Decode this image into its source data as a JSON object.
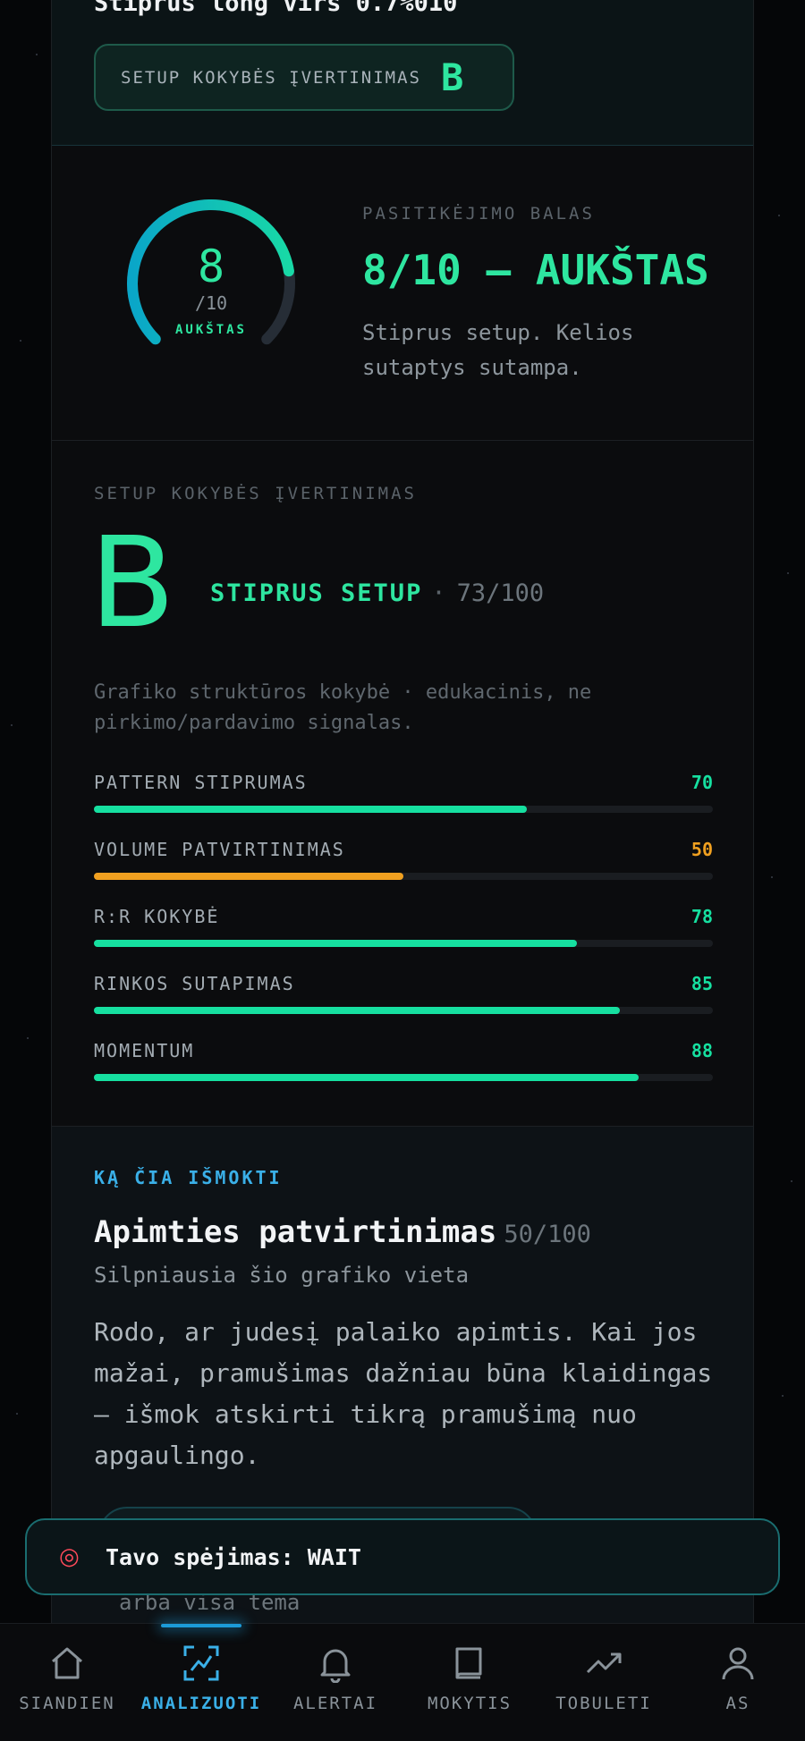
{
  "header": {
    "title": "Stiprus long virš 0.7%010",
    "grade_label": "SETUP KOKYBĖS ĮVERTINIMAS",
    "grade": "B"
  },
  "confidence": {
    "score": "8",
    "out_of": "/10",
    "level": "AUKŠTAS",
    "label": "PASITIKĖJIMO BALAS",
    "title": "8/10 — AUKŠTAS",
    "description": "Stiprus setup. Kelios sutaptys sutampa.",
    "gauge_fraction": 0.8
  },
  "quality": {
    "header": "SETUP KOKYBĖS ĮVERTINIMAS",
    "grade": "B",
    "strength": "STIPRUS SETUP",
    "separator": "·",
    "score": "73/100",
    "note": "Grafiko struktūros kokybė · edukacinis, ne pirkimo/pardavimo signalas.",
    "metrics": [
      {
        "name": "PATTERN STIPRUMAS",
        "value": "70",
        "percent": 70,
        "color": "#16e0a0"
      },
      {
        "name": "VOLUME PATVIRTINIMAS",
        "value": "50",
        "percent": 50,
        "color": "#f0a020"
      },
      {
        "name": "R:R KOKYBĖ",
        "value": "78",
        "percent": 78,
        "color": "#16e0a0"
      },
      {
        "name": "RINKOS SUTAPIMAS",
        "value": "85",
        "percent": 85,
        "color": "#16e0a0"
      },
      {
        "name": "MOMENTUM",
        "value": "88",
        "percent": 88,
        "color": "#16e0a0"
      }
    ]
  },
  "learn": {
    "label": "KĄ ČIA IŠMOKTI",
    "topic": "Apimties patvirtinimas",
    "topic_score": "50/100",
    "subtitle": "Silpniausia šio grafiko vieta",
    "body": "Rodo, ar judesį palaiko apimtis. Kai jos mažai, pramušimas dažniau būna klaidingas — išmok atskirti tikrą pramušimą nuo apgaulingo.",
    "more_text": "arba visa tema"
  },
  "toast": {
    "icon": "target-icon",
    "text": "Tavo spėjimas: WAIT"
  },
  "nav": {
    "items": [
      {
        "label": "SIANDIEN",
        "icon": "home-icon"
      },
      {
        "label": "ANALIZUOTI",
        "icon": "chart-icon"
      },
      {
        "label": "ALERTAI",
        "icon": "bell-icon"
      },
      {
        "label": "MOKYTIS",
        "icon": "book-icon"
      },
      {
        "label": "TOBULETI",
        "icon": "trend-icon"
      },
      {
        "label": "AS",
        "icon": "user-icon"
      }
    ],
    "active_index": 1
  },
  "colors": {
    "accent": "#2ee6a0",
    "info": "#3ab0e8",
    "warning": "#f0a020"
  }
}
